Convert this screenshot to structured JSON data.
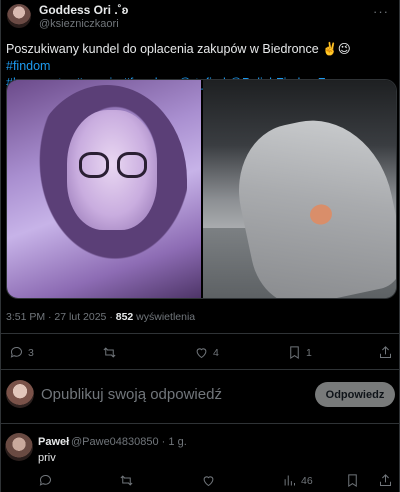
{
  "tweet": {
    "display_name": "Goddess Ori .˚ʚ",
    "handle": "@ksiezniczkaori",
    "more_glyph": "···",
    "text_plain": "Poszukiwany kundel do oplacenia zakupów w Biedronce ✌️😉 ",
    "tags": [
      "#findom",
      "#humanatm",
      "#paypig",
      "#femdom",
      "@rt_find",
      "@PolishFindomFan"
    ],
    "time": "3:51 PM · 27 lut 2025 · ",
    "views_count": "852",
    "views_label": " wyświetlenia",
    "media": [
      "selfie-photo",
      "sock-photo"
    ],
    "actions": {
      "replies": "3",
      "retweets": "",
      "likes": "4",
      "bookmarks": "1",
      "share": ""
    }
  },
  "reply_box": {
    "placeholder": "Opublikuj swoją odpowiedź",
    "button_label": "Odpowiedz"
  },
  "reply": {
    "name": "Paweł",
    "handle_time": "@Pawe04830850 · 1 g.",
    "text": "priv",
    "actions": {
      "views": "46"
    }
  },
  "colors": {
    "background": "#000000",
    "text": "#e7e9ea",
    "muted": "#71767b",
    "link": "#1d9bf0",
    "border": "#2f3336",
    "button": "#787a7a"
  }
}
